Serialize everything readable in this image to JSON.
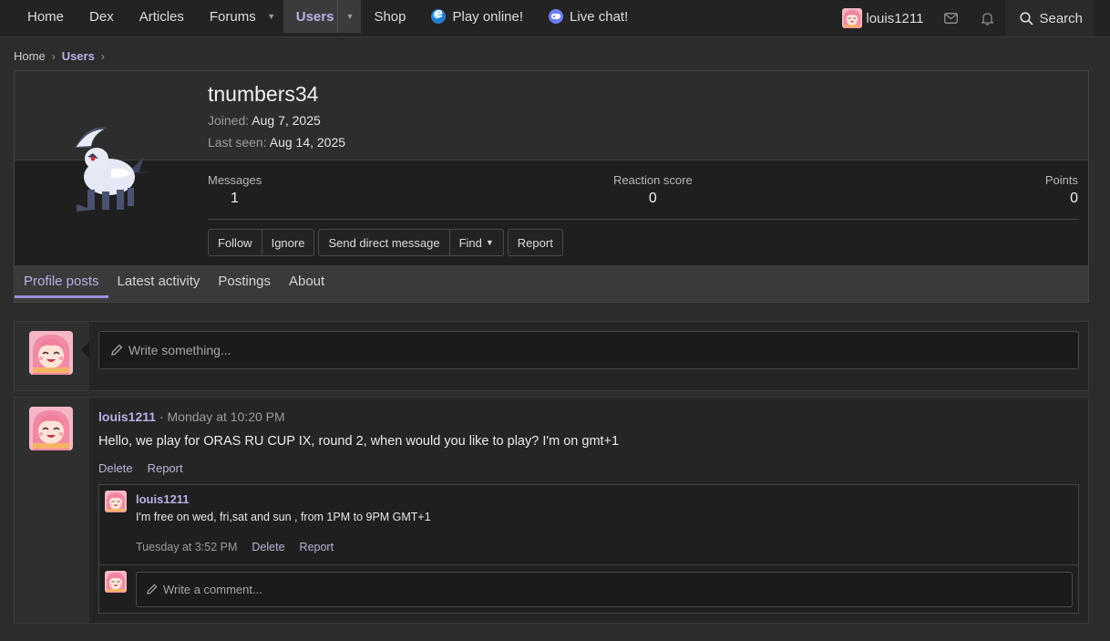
{
  "nav": {
    "items": [
      {
        "label": "Home"
      },
      {
        "label": "Dex"
      },
      {
        "label": "Articles"
      },
      {
        "label": "Forums"
      },
      {
        "label": "Users"
      },
      {
        "label": "Shop"
      },
      {
        "label": "Play online!"
      },
      {
        "label": "Live chat!"
      }
    ],
    "user": "louis1211",
    "search_label": "Search"
  },
  "breadcrumb": [
    "Home",
    "Users"
  ],
  "profile": {
    "username": "tnumbers34",
    "joined_label": "Joined:",
    "joined_value": "Aug 7, 2025",
    "lastseen_label": "Last seen:",
    "lastseen_value": "Aug 14, 2025",
    "stats": [
      {
        "label": "Messages",
        "value": "1"
      },
      {
        "label": "Reaction score",
        "value": "0"
      },
      {
        "label": "Points",
        "value": "0"
      }
    ],
    "actions": {
      "follow": "Follow",
      "ignore": "Ignore",
      "dm": "Send direct message",
      "find": "Find",
      "report": "Report"
    },
    "tabs": [
      "Profile posts",
      "Latest activity",
      "Postings",
      "About"
    ]
  },
  "composer": {
    "placeholder": "Write something..."
  },
  "post": {
    "user": "louis1211",
    "sep": " · ",
    "time": "Monday at 10:20 PM",
    "body": "Hello, we play for ORAS RU CUP IX, round 2, when would you like to play? I'm on gmt+1",
    "delete": "Delete",
    "report": "Report",
    "comment": {
      "user": "louis1211",
      "text": "I'm free on wed, fri,sat and sun , from 1PM to 9PM GMT+1",
      "time": "Tuesday at 3:52 PM",
      "delete": "Delete",
      "report": "Report"
    },
    "comment_placeholder": "Write a comment..."
  },
  "colors": {
    "accent": "#b9b0e6",
    "background": "#2c2c2c",
    "panel": "#1f1f1f"
  }
}
